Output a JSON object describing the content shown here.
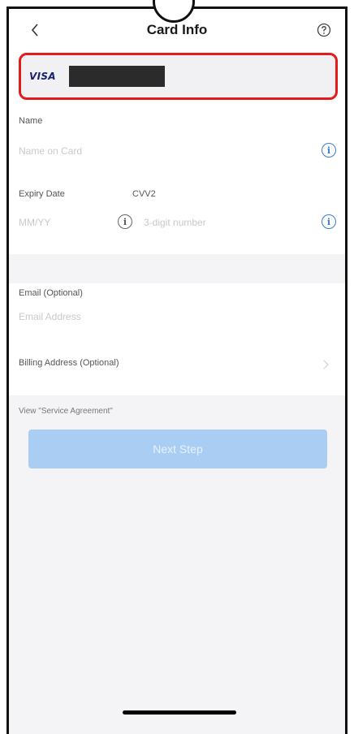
{
  "header": {
    "title": "Card Info",
    "back_icon": "chevron-left-icon",
    "help_icon": "question-circle-icon"
  },
  "card": {
    "brand": "VISA",
    "number_masked": "",
    "highlight_color": "#e31b1b",
    "brand_color": "#1a1f71"
  },
  "form": {
    "name_label": "Name",
    "name_placeholder": "Name on Card",
    "expiry_label": "Expiry Date",
    "expiry_placeholder": "MM/YY",
    "cvv_label": "CVV2",
    "cvv_placeholder": "3-digit number",
    "email_label": "Email (Optional)",
    "email_placeholder": "Email Address",
    "billing_label": "Billing Address (Optional)"
  },
  "footer": {
    "agreement_link": "View \"Service Agreement\"",
    "next_button": "Next Step",
    "button_color": "#a9cdf3"
  }
}
